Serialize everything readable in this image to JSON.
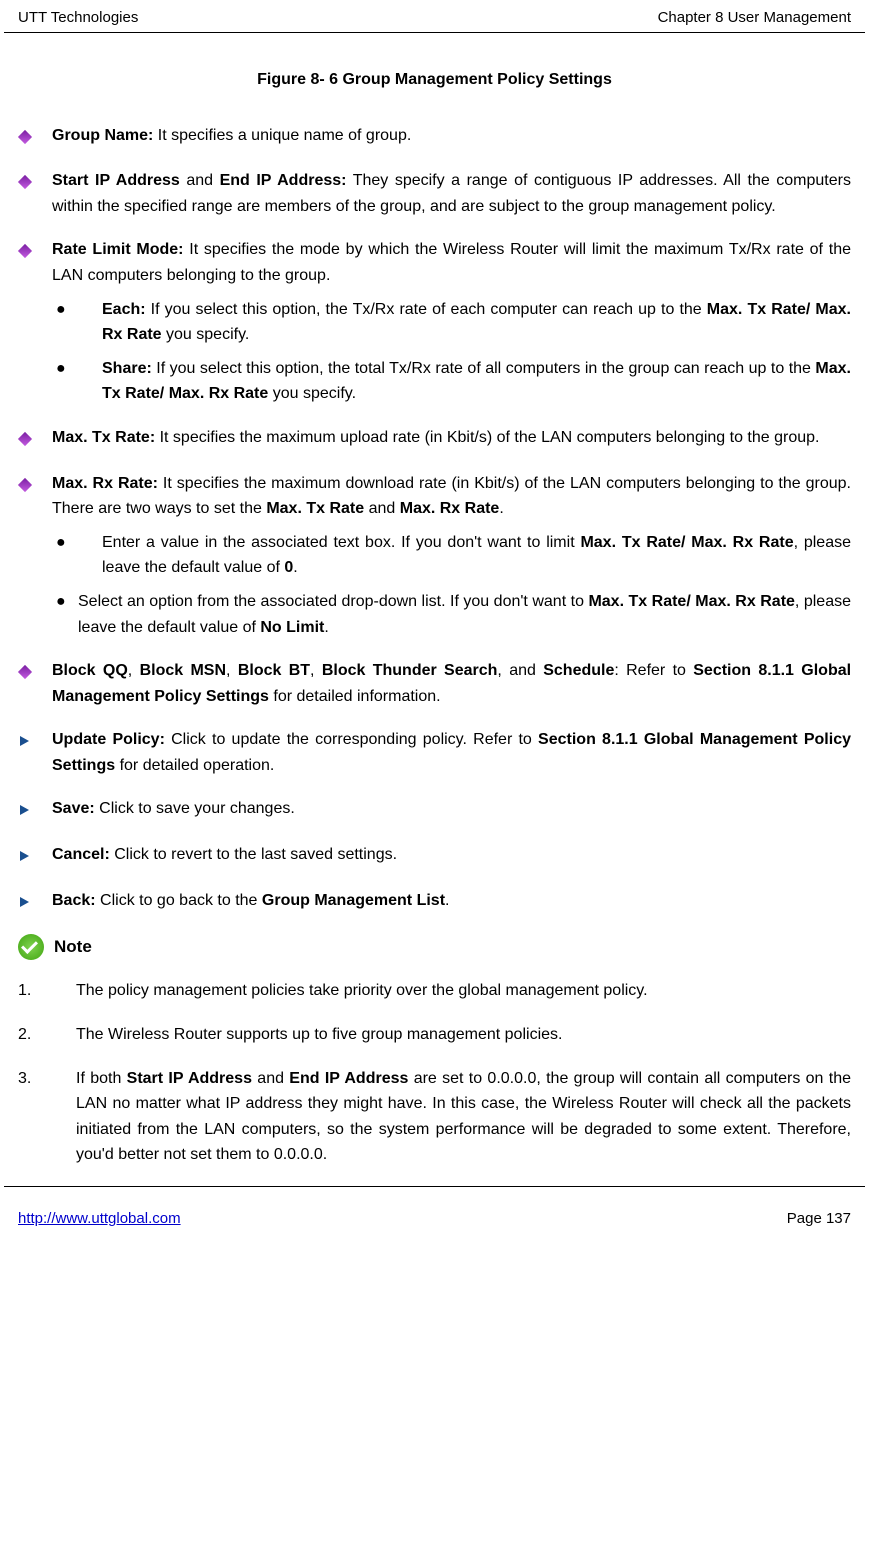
{
  "header": {
    "left": "UTT Technologies",
    "right": "Chapter 8 User Management"
  },
  "caption": "Figure 8- 6    Group Management Policy Settings",
  "bullets": {
    "group_name": {
      "label": "Group Name:",
      "text": " It specifies a unique name of group."
    },
    "ip": {
      "label1": "Start IP Address",
      "mid": " and ",
      "label2": "End IP Address:",
      "text": " They specify a range of contiguous IP addresses. All the computers within the specified range are members of the group, and are subject to the group management policy."
    },
    "rate_mode": {
      "label": "Rate Limit Mode:",
      "text": " It specifies the mode by which the Wireless Router will limit the maximum Tx/Rx rate of the LAN computers belonging to the group."
    },
    "each": {
      "label": "Each:",
      "text1": " If you select this option, the Tx/Rx rate of each computer can reach up to the ",
      "bold1": "Max. Tx Rate/ Max. Rx Rate",
      "text2": " you specify."
    },
    "share": {
      "label": "Share:",
      "text1": " If you select this option, the total Tx/Rx rate of all computers in the group can reach up to the ",
      "bold1": "Max. Tx Rate/ Max. Rx Rate",
      "text2": " you specify."
    },
    "max_tx": {
      "label": "Max. Tx Rate:",
      "text": " It specifies the maximum upload rate (in Kbit/s) of the LAN computers belonging to the group."
    },
    "max_rx": {
      "label": "Max. Rx Rate:",
      "text1": " It specifies the maximum download rate (in Kbit/s) of the LAN computers belonging to the group. There are two ways to set the ",
      "bold1": "Max. Tx Rate",
      "mid": " and ",
      "bold2": "Max. Rx Rate",
      "text2": "."
    },
    "enter_value": {
      "text1": "Enter a value in the associated text box. If you don't want to limit ",
      "bold1": "Max. Tx Rate/ Max. Rx Rate",
      "text2": ", please leave the default value of ",
      "bold2": "0",
      "text3": "."
    },
    "select_option": {
      "text1": "Select an option from the associated drop-down list. If you don't want to ",
      "bold1": "Max. Tx Rate/ Max. Rx Rate",
      "text2": ", please leave the default value of ",
      "bold2": "No Limit",
      "text3": "."
    },
    "block": {
      "b1": "Block QQ",
      "s1": ", ",
      "b2": "Block MSN",
      "s2": ", ",
      "b3": "Block BT",
      "s3": ", ",
      "b4": "Block Thunder Search",
      "s4": ", and ",
      "b5": "Schedule",
      "s5": ": Refer to ",
      "b6": "Section 8.1.1 Global Management Policy Settings",
      "s6": " for detailed information."
    },
    "update": {
      "label": "Update Policy:",
      "text1": " Click to update the corresponding policy. Refer to ",
      "bold1": "Section 8.1.1 Global Management Policy Settings",
      "text2": " for detailed operation."
    },
    "save": {
      "label": "Save:",
      "text": " Click to save your changes."
    },
    "cancel": {
      "label": "Cancel:",
      "text": " Click to revert to the last saved settings."
    },
    "back": {
      "label": "Back:",
      "text1": " Click to go back to the ",
      "bold1": "Group Management List",
      "text2": "."
    }
  },
  "note_label": "Note",
  "notes": {
    "n1": {
      "num": "1.",
      "text": "The policy management policies take priority over the global management policy."
    },
    "n2": {
      "num": "2.",
      "text": "The Wireless Router supports up to five group management policies."
    },
    "n3": {
      "num": "3.",
      "t1": "If both ",
      "b1": "Start IP Address",
      "t2": " and ",
      "b2": "End IP Address",
      "t3": " are set to 0.0.0.0, the group will contain all computers on the LAN no matter what IP address they might have. In this case, the Wireless Router will check all the packets initiated from the LAN computers, so the system performance will be degraded to some extent. Therefore, you'd better not set them to 0.0.0.0."
    }
  },
  "footer": {
    "url": "http://www.uttglobal.com",
    "page": "Page 137"
  }
}
